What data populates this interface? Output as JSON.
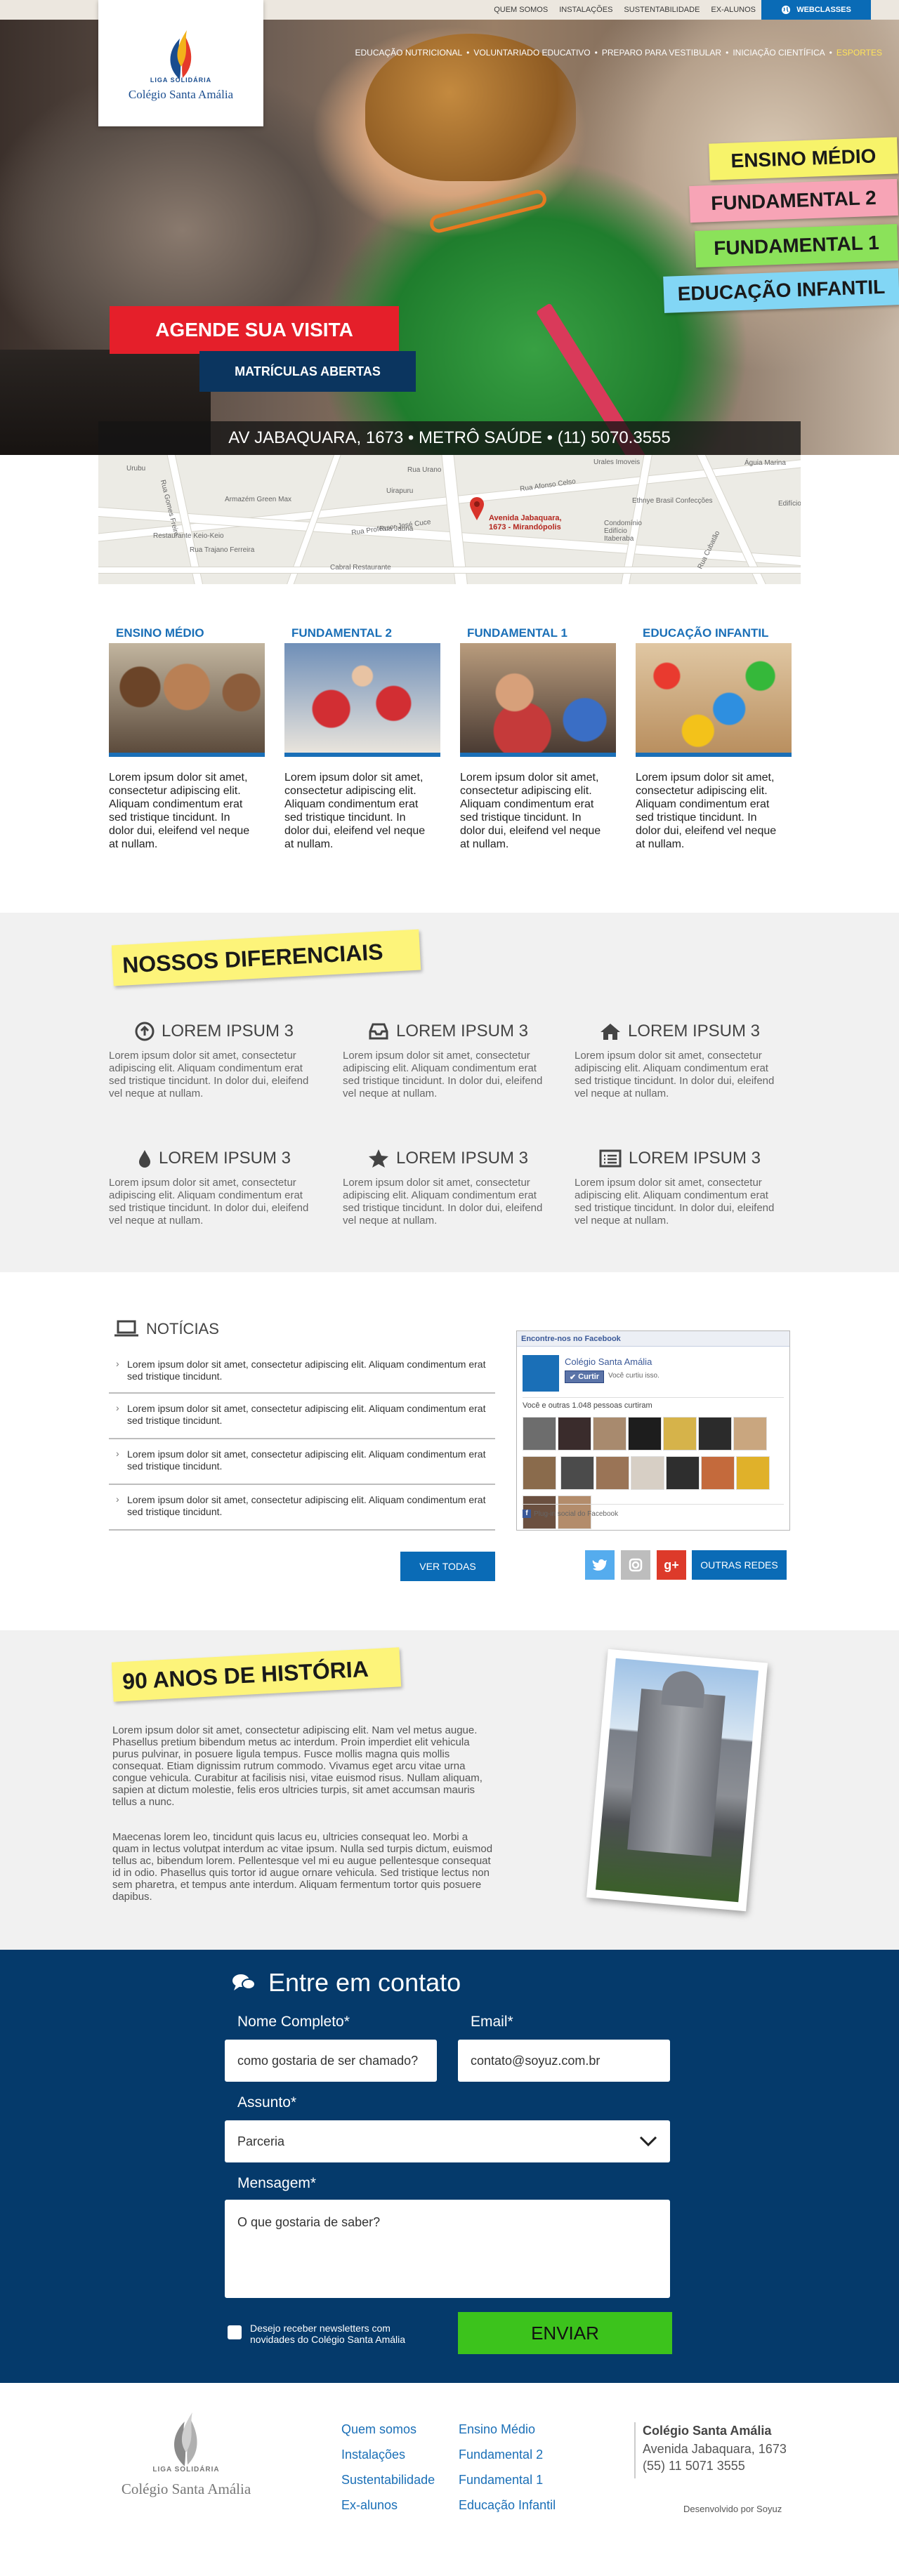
{
  "topbar": {
    "links": [
      "QUEM SOMOS",
      "INSTALAÇÕES",
      "SUSTENTABILIDADE",
      "EX-ALUNOS"
    ],
    "webclasses": "WEBCLASSES"
  },
  "logo": {
    "liga": "LIGA",
    "solidaria": "SOLIDÁRIA",
    "name": "Colégio Santa Amália"
  },
  "nav": {
    "items": [
      "EDUCAÇÃO NUTRICIONAL",
      "VOLUNTARIADO EDUCATIVO",
      "PREPARO PARA VESTIBULAR",
      "INICIAÇÃO CIENTÍFICA",
      "ESPORTES"
    ]
  },
  "hero": {
    "levels": [
      "ENSINO MÉDIO",
      "FUNDAMENTAL 2",
      "FUNDAMENTAL 1",
      "EDUCAÇÃO INFANTIL"
    ],
    "level_colors": [
      "#f7f36a",
      "#f7a4b6",
      "#8be25a",
      "#82d6f5"
    ],
    "cta": "AGENDE SUA VISITA",
    "matriculas": "MATRÍCULAS ABERTAS",
    "address": "AV JABAQUARA, 1673 • METRÔ SAÚDE • (11) 5070.3555"
  },
  "map": {
    "pin_line1": "Avenida Jabaquara,",
    "pin_line2": "1673 - Mirandópolis",
    "labels": [
      "Armazém Green Max",
      "Rua Urano",
      "Uirapuru",
      "Rua Professor José Cuce",
      "Rua Jaúna",
      "Urubu",
      "Rua Trajano Ferreira",
      "Restaurante Keio-Keio",
      "Cabral Restaurante",
      "Ethnye Brasil Confecções",
      "Condomínio Edifício Itaberaba",
      "Águia Marina",
      "Edifício",
      "Urales Imoveis",
      "Rua Afonso Celso",
      "Rua Cubatão",
      "Rua Gomes Freire"
    ]
  },
  "levels": [
    {
      "title": "ENSINO MÉDIO",
      "text": "Lorem ipsum dolor sit amet, consectetur adipiscing elit. Aliquam condimentum erat sed tristique tincidunt. In dolor dui, eleifend vel neque at nullam."
    },
    {
      "title": "FUNDAMENTAL 2",
      "text": "Lorem ipsum dolor sit amet, consectetur adipiscing elit. Aliquam condimentum erat sed tristique tincidunt. In dolor dui, eleifend vel neque at nullam."
    },
    {
      "title": "FUNDAMENTAL 1",
      "text": "Lorem ipsum dolor sit amet, consectetur adipiscing elit. Aliquam condimentum erat sed tristique tincidunt. In dolor dui, eleifend vel neque at nullam."
    },
    {
      "title": "EDUCAÇÃO INFANTIL",
      "text": "Lorem ipsum dolor sit amet, consectetur adipiscing elit. Aliquam condimentum erat sed tristique tincidunt. In dolor dui, eleifend vel neque at nullam."
    }
  ],
  "diferenciais": {
    "title": "NOSSOS DIFERENCIAIS",
    "items": [
      {
        "icon": "arrow-up-circle-icon",
        "title": "LOREM IPSUM 3",
        "text": "Lorem ipsum dolor sit amet, consectetur adipiscing elit. Aliquam condimentum erat sed tristique tincidunt. In dolor dui, eleifend vel neque at nullam."
      },
      {
        "icon": "inbox-icon",
        "title": "LOREM IPSUM 3",
        "text": "Lorem ipsum dolor sit amet, consectetur adipiscing elit. Aliquam condimentum erat sed tristique tincidunt. In dolor dui, eleifend vel neque at nullam."
      },
      {
        "icon": "home-icon",
        "title": "LOREM IPSUM 3",
        "text": "Lorem ipsum dolor sit amet, consectetur adipiscing elit. Aliquam condimentum erat sed tristique tincidunt. In dolor dui, eleifend vel neque at nullam."
      },
      {
        "icon": "drop-icon",
        "title": "LOREM IPSUM 3",
        "text": "Lorem ipsum dolor sit amet, consectetur adipiscing elit. Aliquam condimentum erat sed tristique tincidunt. In dolor dui, eleifend vel neque at nullam."
      },
      {
        "icon": "star-icon",
        "title": "LOREM IPSUM 3",
        "text": "Lorem ipsum dolor sit amet, consectetur adipiscing elit. Aliquam condimentum erat sed tristique tincidunt. In dolor dui, eleifend vel neque at nullam."
      },
      {
        "icon": "list-icon",
        "title": "LOREM IPSUM 3",
        "text": "Lorem ipsum dolor sit amet, consectetur adipiscing elit. Aliquam condimentum erat sed tristique tincidunt. In dolor dui, eleifend vel neque at nullam."
      }
    ]
  },
  "news": {
    "title": "NOTÍCIAS",
    "items": [
      "Lorem ipsum dolor sit amet, consectetur adipiscing elit. Aliquam condimentum erat sed tristique tincidunt.",
      "Lorem ipsum dolor sit amet, consectetur adipiscing elit. Aliquam condimentum erat sed tristique tincidunt.",
      "Lorem ipsum dolor sit amet, consectetur adipiscing elit. Aliquam condimentum erat sed tristique tincidunt.",
      "Lorem ipsum dolor sit amet, consectetur adipiscing elit. Aliquam condimentum erat sed tristique tincidunt."
    ],
    "ver_todas": "VER TODAS"
  },
  "facebook": {
    "header": "Encontre-nos no Facebook",
    "page_name": "Colégio Santa Amália",
    "like_button": "Curtir",
    "liked_text": "Você curtiu isso.",
    "people_text": "Você e outras 1.048 pessoas curtiram",
    "plugin_text": "Plug-in social do Facebook"
  },
  "social": {
    "outras_redes": "OUTRAS REDES"
  },
  "history": {
    "title": "90 ANOS DE HISTÓRIA",
    "p1": "Lorem ipsum dolor sit amet, consectetur adipiscing elit. Nam vel metus augue. Phasellus pretium bibendum metus ac interdum. Proin imperdiet elit vehicula purus pulvinar, in posuere ligula tempus. Fusce mollis magna quis mollis consequat. Etiam dignissim rutrum commodo. Vivamus eget arcu vitae urna congue vehicula. Curabitur at facilisis nisi, vitae euismod risus. Nullam aliquam, sapien at dictum molestie, felis eros ultricies turpis, sit amet accumsan mauris tellus a nunc.",
    "p2": "Maecenas lorem leo, tincidunt quis lacus eu, ultricies consequat leo. Morbi a quam in lectus volutpat interdum ac vitae ipsum. Nulla sed turpis dictum, euismod tellus ac, bibendum lorem. Pellentesque vel mi eu augue pellentesque consequat id in odio. Phasellus quis tortor id augue ornare vehicula. Sed tristique lectus non sem pharetra, et tempus ante interdum. Aliquam fermentum tortor quis posuere dapibus."
  },
  "contact": {
    "title": "Entre em contato",
    "name_label": "Nome Completo*",
    "name_placeholder": "como gostaria de ser chamado?",
    "email_label": "Email*",
    "email_placeholder": "contato@soyuz.com.br",
    "subject_label": "Assunto*",
    "subject_value": "Parceria",
    "message_label": "Mensagem*",
    "message_placeholder": "O que gostaria de saber?",
    "newsletter": "Desejo receber newsletters com novidades do Colégio Santa Amália",
    "submit": "ENVIAR"
  },
  "footer": {
    "col1": [
      "Quem somos",
      "Instalações",
      "Sustentabilidade",
      "Ex-alunos"
    ],
    "col2": [
      "Ensino Médio",
      "Fundamental 2",
      "Fundamental 1",
      "Educação Infantil"
    ],
    "school_name": "Colégio Santa Amália",
    "address": "Avenida Jabaquara, 1673",
    "phone": "(55) 11 5071 3555",
    "developed_by": "Desenvolvido por Soyuz"
  },
  "colors": {
    "brand_blue": "#1a6fb7",
    "dark_blue": "#053a6b",
    "red": "#e51f2a",
    "green": "#3cc31c",
    "note_yellow": "#fdf47a"
  }
}
